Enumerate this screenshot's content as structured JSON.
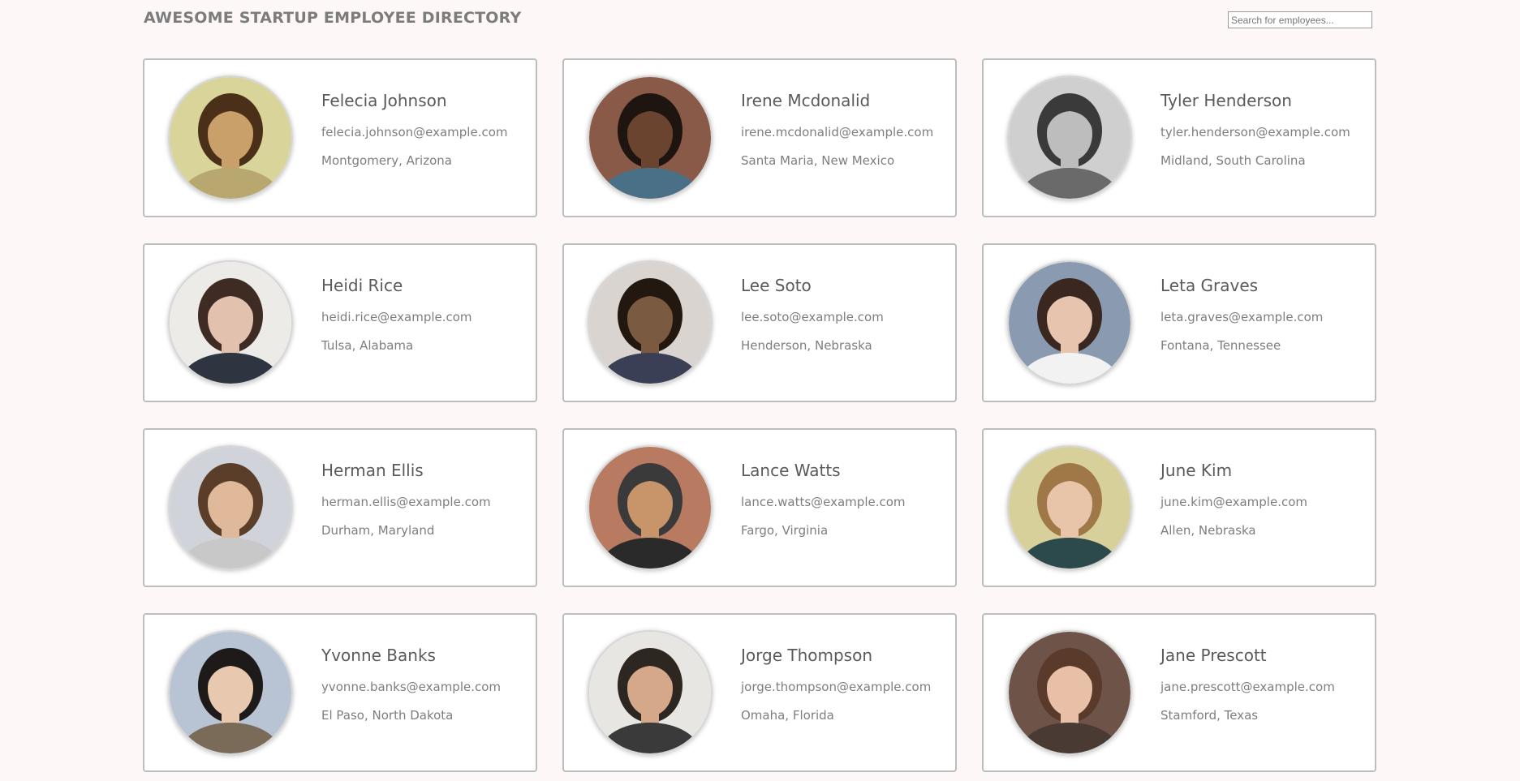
{
  "header": {
    "title": "AWESOME STARTUP EMPLOYEE DIRECTORY",
    "search_placeholder": "Search for employees..."
  },
  "employees": [
    {
      "name": "Felecia Johnson",
      "email": "felecia.johnson@example.com",
      "location": "Montgomery, Arizona",
      "avatar": {
        "bg": "#d8d49a",
        "skin": "#c9a06a",
        "hair": "#4a3018",
        "shirt": "#b8a870"
      }
    },
    {
      "name": "Irene Mcdonalid",
      "email": "irene.mcdonalid@example.com",
      "location": "Santa Maria, New Mexico",
      "avatar": {
        "bg": "#8a5a48",
        "skin": "#6b4430",
        "hair": "#1e1410",
        "shirt": "#4a7088"
      }
    },
    {
      "name": "Tyler Henderson",
      "email": "tyler.henderson@example.com",
      "location": "Midland, South Carolina",
      "avatar": {
        "bg": "#cfcfcf",
        "skin": "#bdbdbd",
        "hair": "#3a3a3a",
        "shirt": "#6a6a6a"
      }
    },
    {
      "name": "Heidi Rice",
      "email": "heidi.rice@example.com",
      "location": "Tulsa, Alabama",
      "avatar": {
        "bg": "#ecebe8",
        "skin": "#e2c2ae",
        "hair": "#3e2c24",
        "shirt": "#2e3440"
      }
    },
    {
      "name": "Lee Soto",
      "email": "lee.soto@example.com",
      "location": "Henderson, Nebraska",
      "avatar": {
        "bg": "#d9d4cf",
        "skin": "#7a5a40",
        "hair": "#22180f",
        "shirt": "#3a3f55"
      }
    },
    {
      "name": "Leta Graves",
      "email": "leta.graves@example.com",
      "location": "Fontana, Tennessee",
      "avatar": {
        "bg": "#8a9ab0",
        "skin": "#e6c4ae",
        "hair": "#3a2820",
        "shirt": "#f2f2f2"
      }
    },
    {
      "name": "Herman Ellis",
      "email": "herman.ellis@example.com",
      "location": "Durham, Maryland",
      "avatar": {
        "bg": "#d0d4da",
        "skin": "#e0b89a",
        "hair": "#5a3e2a",
        "shirt": "#c8c8c8"
      }
    },
    {
      "name": "Lance Watts",
      "email": "lance.watts@example.com",
      "location": "Fargo, Virginia",
      "avatar": {
        "bg": "#b87a60",
        "skin": "#c8946a",
        "hair": "#3a3a3a",
        "shirt": "#2a2a2a"
      }
    },
    {
      "name": "June Kim",
      "email": "june.kim@example.com",
      "location": "Allen, Nebraska",
      "avatar": {
        "bg": "#d8d09a",
        "skin": "#e8c4a8",
        "hair": "#a07848",
        "shirt": "#2c4a4c"
      }
    },
    {
      "name": "Yvonne Banks",
      "email": "yvonne.banks@example.com",
      "location": "El Paso, North Dakota",
      "avatar": {
        "bg": "#b8c4d4",
        "skin": "#e8c8ae",
        "hair": "#1e1a1a",
        "shirt": "#7a6a58"
      }
    },
    {
      "name": "Jorge Thompson",
      "email": "jorge.thompson@example.com",
      "location": "Omaha, Florida",
      "avatar": {
        "bg": "#e8e6e2",
        "skin": "#d4a888",
        "hair": "#2e2620",
        "shirt": "#3a3a3a"
      }
    },
    {
      "name": "Jane Prescott",
      "email": "jane.prescott@example.com",
      "location": "Stamford, Texas",
      "avatar": {
        "bg": "#6e5448",
        "skin": "#e8c0a8",
        "hair": "#5a3a2a",
        "shirt": "#4a3a34"
      }
    }
  ]
}
